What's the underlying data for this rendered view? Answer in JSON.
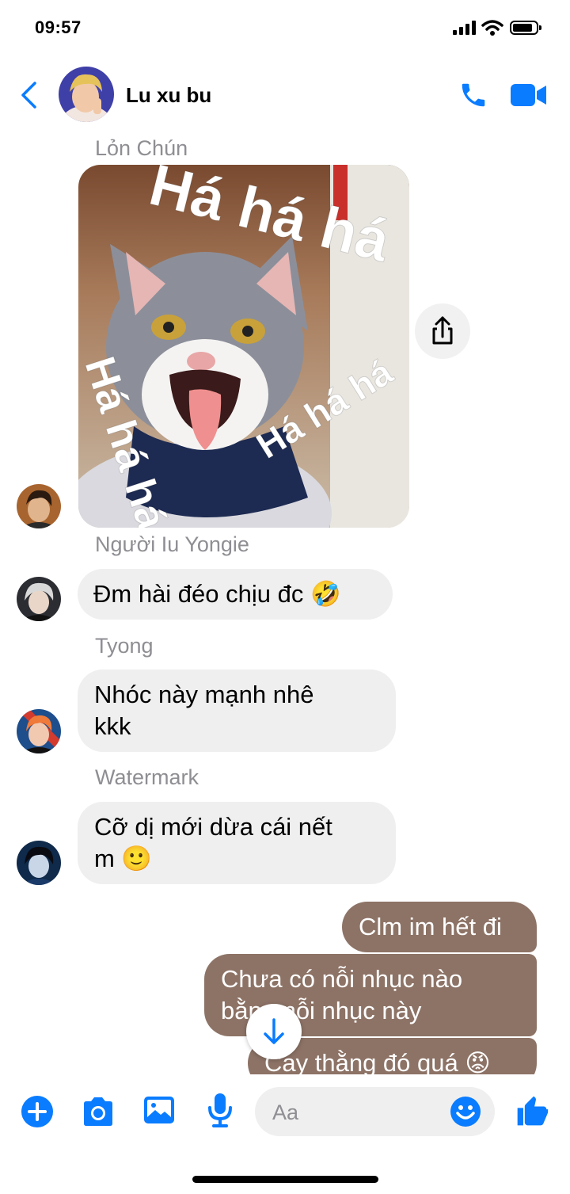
{
  "status_bar": {
    "time": "09:57"
  },
  "header": {
    "contact_name": "Lu xu bu"
  },
  "messages": [
    {
      "sender": "Lỏn Chún",
      "type": "image",
      "captions": [
        "Há há há",
        "Há há há",
        "Há há há"
      ]
    },
    {
      "sender": "Người Iu Yongie",
      "text": "Đm hài đéo chịu đc 🤣"
    },
    {
      "sender": "Tyong",
      "lines": [
        "Nhóc này mạnh nhê",
        "kkk"
      ]
    },
    {
      "sender": "Watermark",
      "lines": [
        "Cỡ dị mới dừa cái nết",
        "m 🙂"
      ]
    }
  ],
  "outgoing": [
    {
      "text": "Clm im hết đi"
    },
    {
      "lines": [
        "Chưa có nỗi nhục nào",
        "bằng nỗi nhục này"
      ]
    },
    {
      "text": "Cay thằng đó quá 😡"
    }
  ],
  "composer": {
    "placeholder": "Aa"
  },
  "colors": {
    "accent": "#0a7cff",
    "outgoing_bubble": "#8d7366",
    "incoming_bubble": "#efefef"
  },
  "icons": [
    "back-chevron-icon",
    "phone-icon",
    "video-camera-icon",
    "share-icon",
    "scroll-down-arrow-icon",
    "add-icon",
    "camera-icon",
    "image-icon",
    "microphone-icon",
    "emoji-icon",
    "thumbs-up-icon"
  ]
}
